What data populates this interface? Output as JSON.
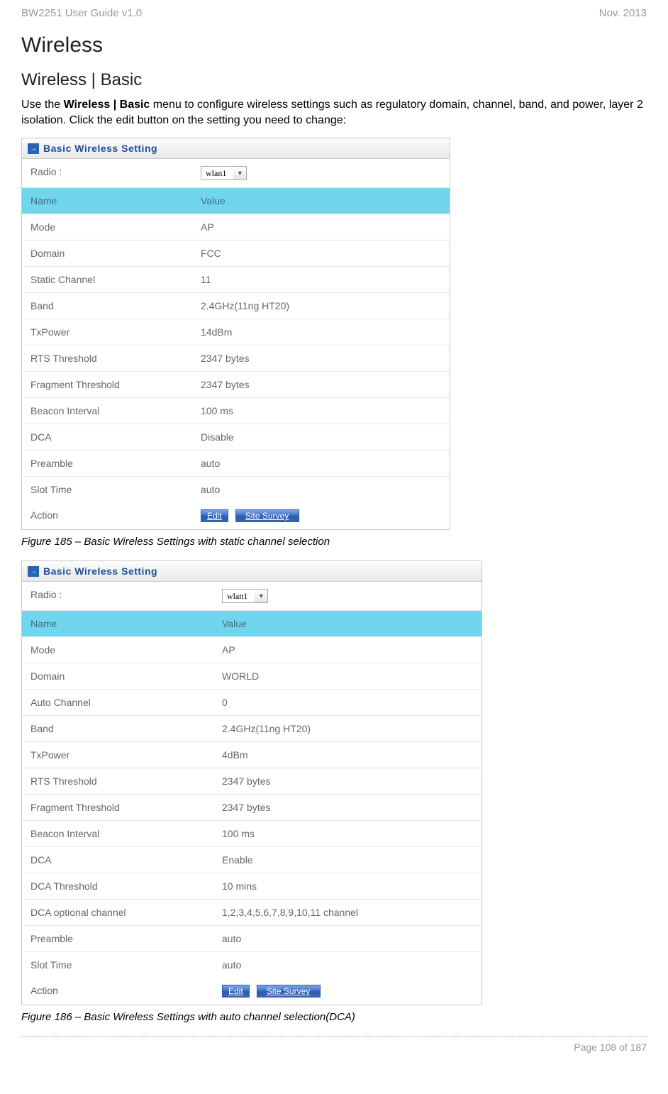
{
  "header": {
    "left": "BW2251 User Guide v1.0",
    "right": "Nov.  2013"
  },
  "title_main": "Wireless",
  "title_sub": "Wireless | Basic",
  "intro_pre": "Use the ",
  "intro_bold": "Wireless | Basic",
  "intro_post": " menu to configure wireless settings such as regulatory domain, channel, band, and power, layer 2 isolation. Click the edit button on the setting you need to change:",
  "panel_title": "Basic Wireless Setting",
  "header_row": {
    "name": "Name",
    "value": "Value"
  },
  "radio_label": "Radio :",
  "radio_value": "wlan1",
  "action_label": "Action",
  "btn_edit": "Edit",
  "btn_survey": "Site Survey",
  "table1": {
    "rows": [
      {
        "n": "Mode",
        "v": "AP"
      },
      {
        "n": "Domain",
        "v": "FCC"
      },
      {
        "n": "Static Channel",
        "v": "11"
      },
      {
        "n": "Band",
        "v": "2.4GHz(11ng HT20)"
      },
      {
        "n": "TxPower",
        "v": "14dBm"
      },
      {
        "n": "RTS Threshold",
        "v": "2347 bytes"
      },
      {
        "n": "Fragment Threshold",
        "v": "2347 bytes"
      },
      {
        "n": "Beacon Interval",
        "v": "100 ms"
      },
      {
        "n": "DCA",
        "v": "Disable"
      },
      {
        "n": "Preamble",
        "v": "auto"
      },
      {
        "n": "Slot Time",
        "v": "auto"
      }
    ]
  },
  "caption1": "Figure 185 – Basic Wireless Settings with static channel selection",
  "table2": {
    "rows": [
      {
        "n": "Mode",
        "v": "AP"
      },
      {
        "n": "Domain",
        "v": "WORLD"
      },
      {
        "n": "Auto Channel",
        "v": "0"
      },
      {
        "n": "Band",
        "v": "2.4GHz(11ng HT20)"
      },
      {
        "n": "TxPower",
        "v": "4dBm"
      },
      {
        "n": "RTS Threshold",
        "v": "2347 bytes"
      },
      {
        "n": "Fragment Threshold",
        "v": "2347 bytes"
      },
      {
        "n": "Beacon Interval",
        "v": "100 ms"
      },
      {
        "n": "DCA",
        "v": "Enable"
      },
      {
        "n": "DCA Threshold",
        "v": "10 mins"
      },
      {
        "n": "DCA optional channel",
        "v": "1,2,3,4,5,6,7,8,9,10,11 channel"
      },
      {
        "n": "Preamble",
        "v": "auto"
      },
      {
        "n": "Slot Time",
        "v": "auto"
      }
    ]
  },
  "caption2": "Figure 186 – Basic Wireless Settings with auto channel selection(DCA)",
  "footer": "Page 108 of 187"
}
